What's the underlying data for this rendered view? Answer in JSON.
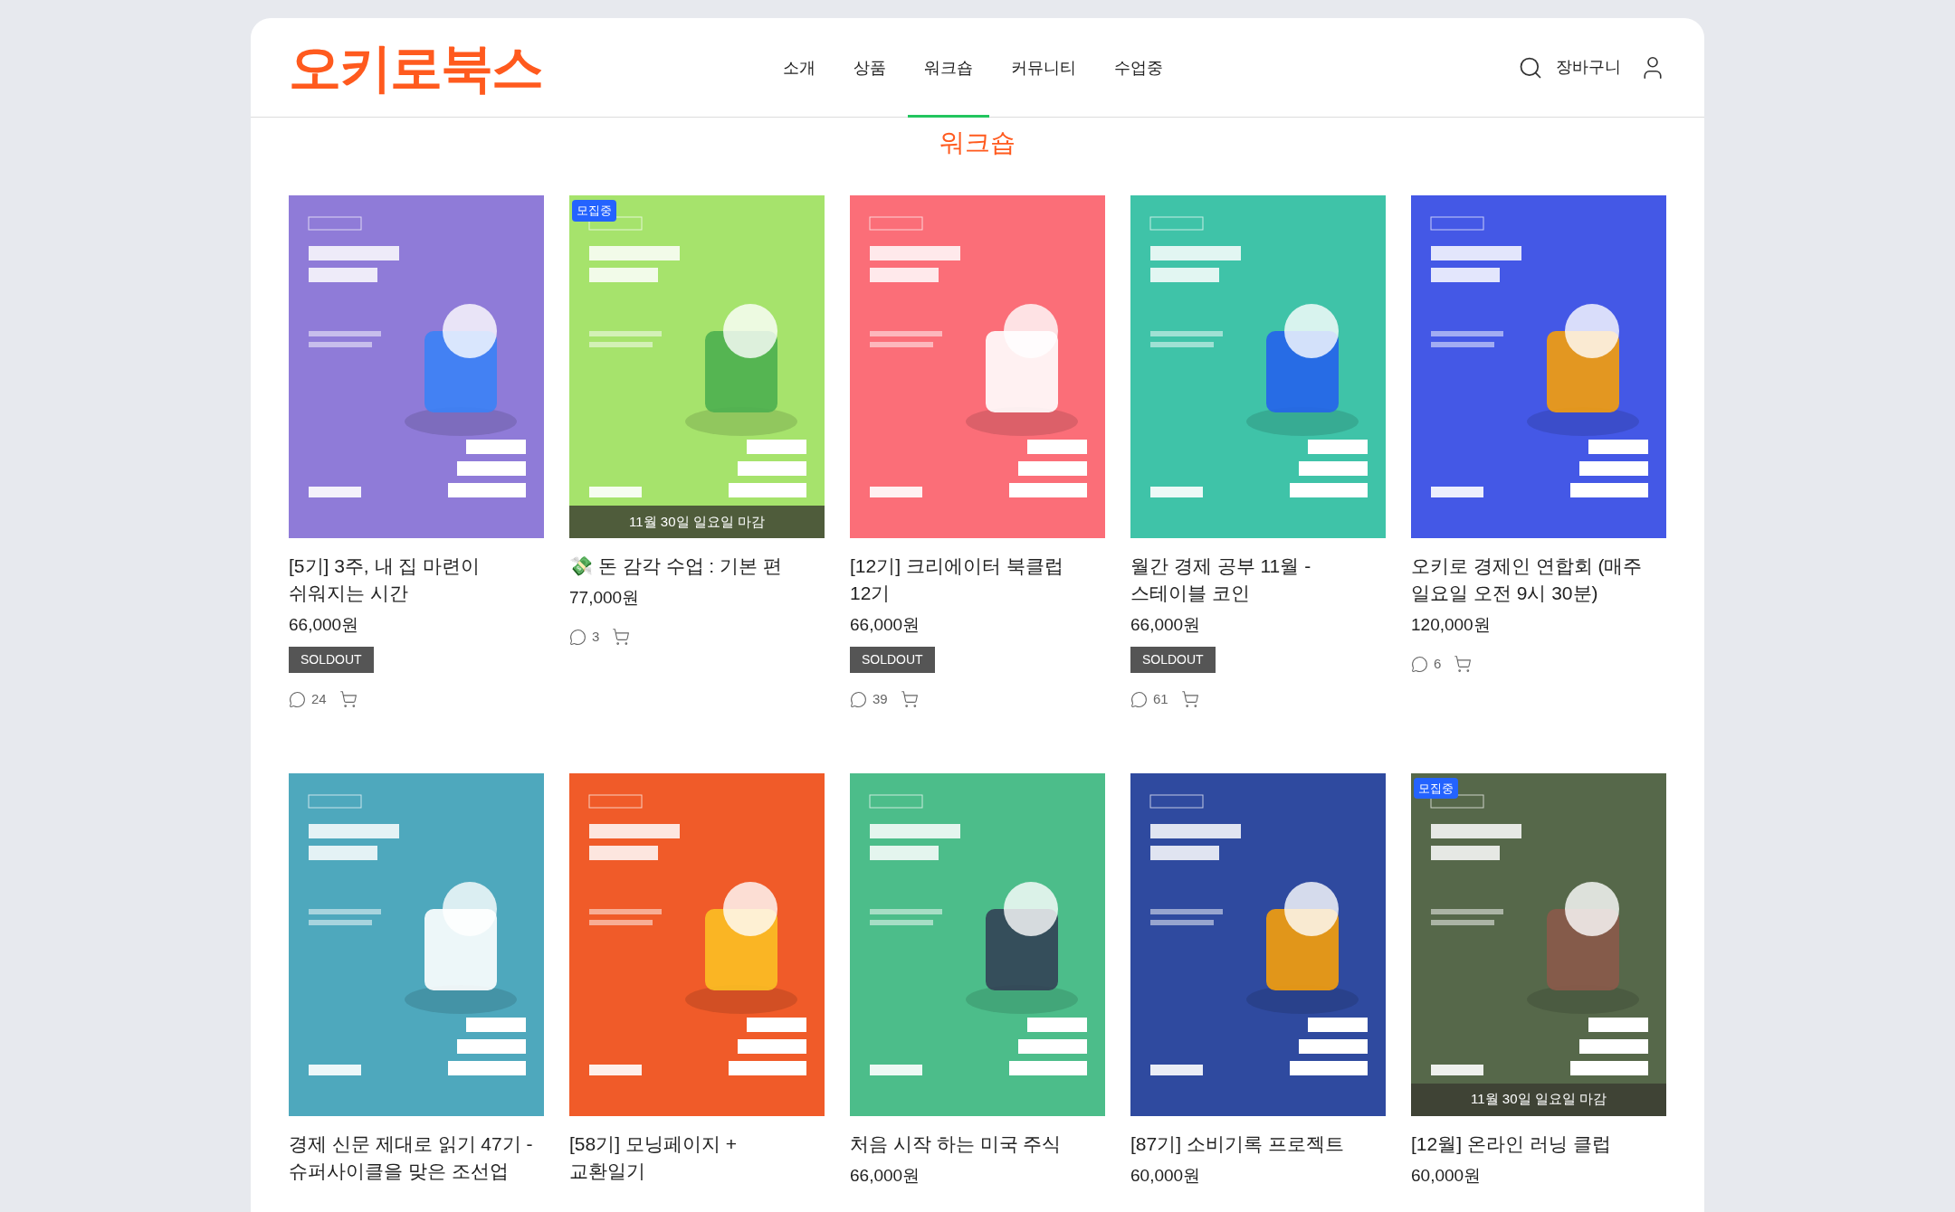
{
  "header": {
    "logo": "오키로북스",
    "nav": [
      {
        "label": "소개",
        "selected": false
      },
      {
        "label": "상품",
        "selected": false
      },
      {
        "label": "워크숍",
        "selected": true
      },
      {
        "label": "커뮤니티",
        "selected": false
      },
      {
        "label": "수업중",
        "selected": false
      }
    ],
    "cart": "장바구니"
  },
  "page_title": "워크숍",
  "products": [
    {
      "title": "[5기] 3주, 내 집 마련이 쉬워지는 시간",
      "price": "66,000원",
      "soldout": "SOLDOUT",
      "comments": "24"
    },
    {
      "title": "💸 돈 감각 수업 : 기본 편",
      "price": "77,000원",
      "comments": "3",
      "badge": "모집중",
      "deadline": "11월 30일 일요일 마감"
    },
    {
      "title": "[12기] 크리에이터 북클럽 12기",
      "price": "66,000원",
      "soldout": "SOLDOUT",
      "comments": "39"
    },
    {
      "title": "월간 경제 공부 11월 - 스테이블 코인",
      "price": "66,000원",
      "soldout": "SOLDOUT",
      "comments": "61"
    },
    {
      "title": "오키로 경제인 연합회 (매주 일요일 오전 9시 30분)",
      "price": "120,000원",
      "comments": "6"
    },
    {
      "title": "경제 신문 제대로 읽기 47기 - 슈퍼사이클을 맞은 조선업"
    },
    {
      "title": "[58기] 모닝페이지 + 교환일기"
    },
    {
      "title": "처음 시작 하는 미국 주식",
      "price": "66,000원"
    },
    {
      "title": "[87기] 소비기록 프로젝트",
      "price": "60,000원"
    },
    {
      "title": "[12월] 온라인 러닝 클럽",
      "price": "60,000원",
      "badge": "모집중",
      "deadline": "11월 30일 일요일 마감"
    }
  ]
}
